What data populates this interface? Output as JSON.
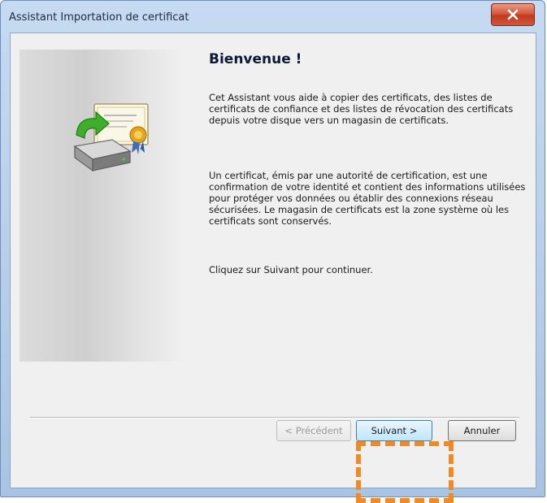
{
  "window": {
    "title": "Assistant Importation de certificat",
    "close_icon": "close-icon"
  },
  "content": {
    "heading": "Bienvenue !",
    "paragraph1": "Cet Assistant vous aide à copier des certificats, des listes de certificats de confiance et des listes de révocation des certificats depuis votre disque vers un magasin de certificats.",
    "paragraph2": "Un certificat, émis par une autorité de certification, est une confirmation de votre identité et contient des informations utilisées pour protéger vos données ou établir des connexions réseau sécurisées. Le magasin de certificats est la zone système où les certificats sont conservés.",
    "paragraph3": "Cliquez sur Suivant pour continuer."
  },
  "buttons": {
    "previous": "< Précédent",
    "next": "Suivant >",
    "cancel": "Annuler"
  },
  "colors": {
    "highlight": "#f08a24",
    "close_button": "#c9452a",
    "next_button_border": "#3c7fb1"
  }
}
